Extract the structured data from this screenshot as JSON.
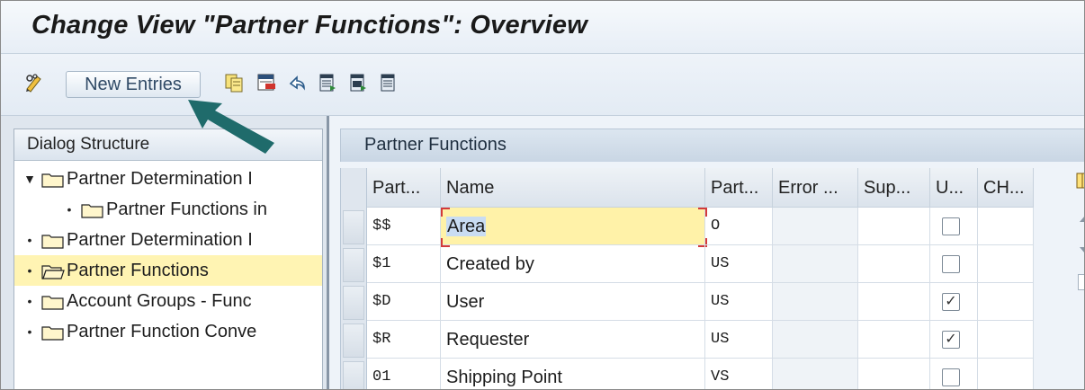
{
  "window": {
    "title": "Change View \"Partner Functions\": Overview"
  },
  "toolbar": {
    "new_entries_label": "New Entries",
    "icons": [
      "display-change-icon",
      "copy-icon",
      "delete-icon",
      "undo-icon",
      "select-all-icon",
      "select-block-icon",
      "deselect-all-icon"
    ]
  },
  "dialog_structure": {
    "header": "Dialog Structure",
    "items": [
      {
        "label": "Partner Determination I",
        "level": 0,
        "expanded": true,
        "selected": false
      },
      {
        "label": "Partner Functions in",
        "level": 1,
        "expanded": false,
        "selected": false
      },
      {
        "label": "Partner Determination I",
        "level": 0,
        "expanded": false,
        "selected": false
      },
      {
        "label": "Partner Functions",
        "level": 0,
        "expanded": false,
        "selected": true
      },
      {
        "label": "Account Groups - Func",
        "level": 0,
        "expanded": false,
        "selected": false
      },
      {
        "label": "Partner Function Conve",
        "level": 0,
        "expanded": false,
        "selected": false
      }
    ]
  },
  "table": {
    "title": "Partner Functions",
    "columns": [
      "Part...",
      "Name",
      "Part...",
      "Error ...",
      "Sup...",
      "U...",
      "CH..."
    ],
    "rows": [
      {
        "code": "$$",
        "name": "Area",
        "type": "O",
        "error": "",
        "sup": "",
        "u": false,
        "ch": ""
      },
      {
        "code": "$1",
        "name": "Created by",
        "type": "US",
        "error": "",
        "sup": "",
        "u": false,
        "ch": ""
      },
      {
        "code": "$D",
        "name": "User",
        "type": "US",
        "error": "",
        "sup": "",
        "u": true,
        "ch": ""
      },
      {
        "code": "$R",
        "name": "Requester",
        "type": "US",
        "error": "",
        "sup": "",
        "u": true,
        "ch": ""
      },
      {
        "code": "01",
        "name": "Shipping Point",
        "type": "VS",
        "error": "",
        "sup": "",
        "u": false,
        "ch": ""
      }
    ]
  },
  "colors": {
    "selected_row": "#fff4b3",
    "active_cell": "#fff2a8",
    "arrow": "#1f6b6b"
  }
}
